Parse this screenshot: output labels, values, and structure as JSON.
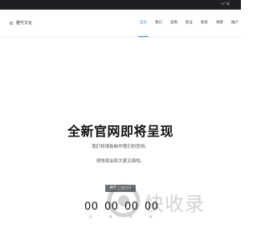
{
  "topbar": {
    "text": "+广场"
  },
  "brand": {
    "name": "雅竹文化"
  },
  "nav": {
    "items": [
      {
        "label": "首页",
        "active": true
      },
      {
        "label": "我们",
        "active": false
      },
      {
        "label": "案例",
        "active": false
      },
      {
        "label": "职业",
        "active": false
      },
      {
        "label": "联系",
        "active": false
      },
      {
        "label": "博客",
        "active": false
      },
      {
        "label": "推介",
        "active": false
      }
    ]
  },
  "hero": {
    "title": "全新官网即将呈现",
    "line1": "我们将很新制作我们的官网。",
    "line2": "很快就会和大家见面啦。"
  },
  "countdown": {
    "label": "剩余上线时间",
    "days": "00",
    "hours": "00",
    "minutes": "00",
    "seconds": "00",
    "day_unit": "天",
    "hour_unit": "时",
    "minute_unit": "分",
    "second_unit": "秒"
  },
  "watermark": {
    "text": "快收录"
  },
  "colors": {
    "accent": "#2f8ae0",
    "topbar": "#1e1f22"
  }
}
